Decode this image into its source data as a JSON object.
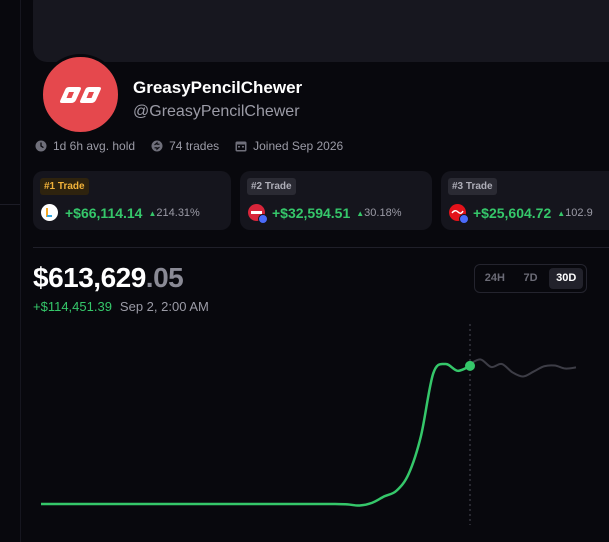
{
  "profile": {
    "display_name": "GreasyPencilChewer",
    "handle": "@GreasyPencilChewer",
    "avatar_color": "#e5484d"
  },
  "stats": {
    "avg_hold": "1d 6h avg. hold",
    "trades": "74 trades",
    "joined": "Joined Sep 2026"
  },
  "top_trades": [
    {
      "rank": "#1 Trade",
      "token_icon": "l-token-icon",
      "value": "+$66,114.14",
      "pct": "214.31%"
    },
    {
      "rank": "#2 Trade",
      "token_icon": "amc-token-icon",
      "value": "+$32,594.51",
      "pct": "30.18%"
    },
    {
      "rank": "#3 Trade",
      "token_icon": "coke-token-icon",
      "value": "+$25,604.72",
      "pct": "102.9"
    }
  ],
  "portfolio": {
    "balance_main": "$613,629",
    "balance_decimals": ".05",
    "change": "+$114,451.39",
    "timestamp": "Sep 2, 2:00 AM"
  },
  "range": {
    "options": [
      "24H",
      "7D",
      "30D"
    ],
    "selected": "30D"
  },
  "colors": {
    "positive": "#35c76a",
    "background": "#08080d",
    "card": "#15151d"
  },
  "chart_data": {
    "type": "line",
    "series": [
      {
        "values": [
          100,
          100,
          100,
          100,
          100,
          100,
          100,
          100,
          100,
          100,
          100,
          100,
          100,
          100,
          100,
          100,
          100,
          100,
          100,
          100,
          100,
          100,
          100,
          100,
          100,
          99,
          96,
          103,
          120,
          135,
          180,
          280,
          445,
          470,
          452,
          465
        ]
      },
      {
        "values": [
          470,
          482,
          462,
          470,
          448,
          437,
          450,
          464,
          466,
          458,
          461
        ]
      }
    ],
    "grid": false
  }
}
